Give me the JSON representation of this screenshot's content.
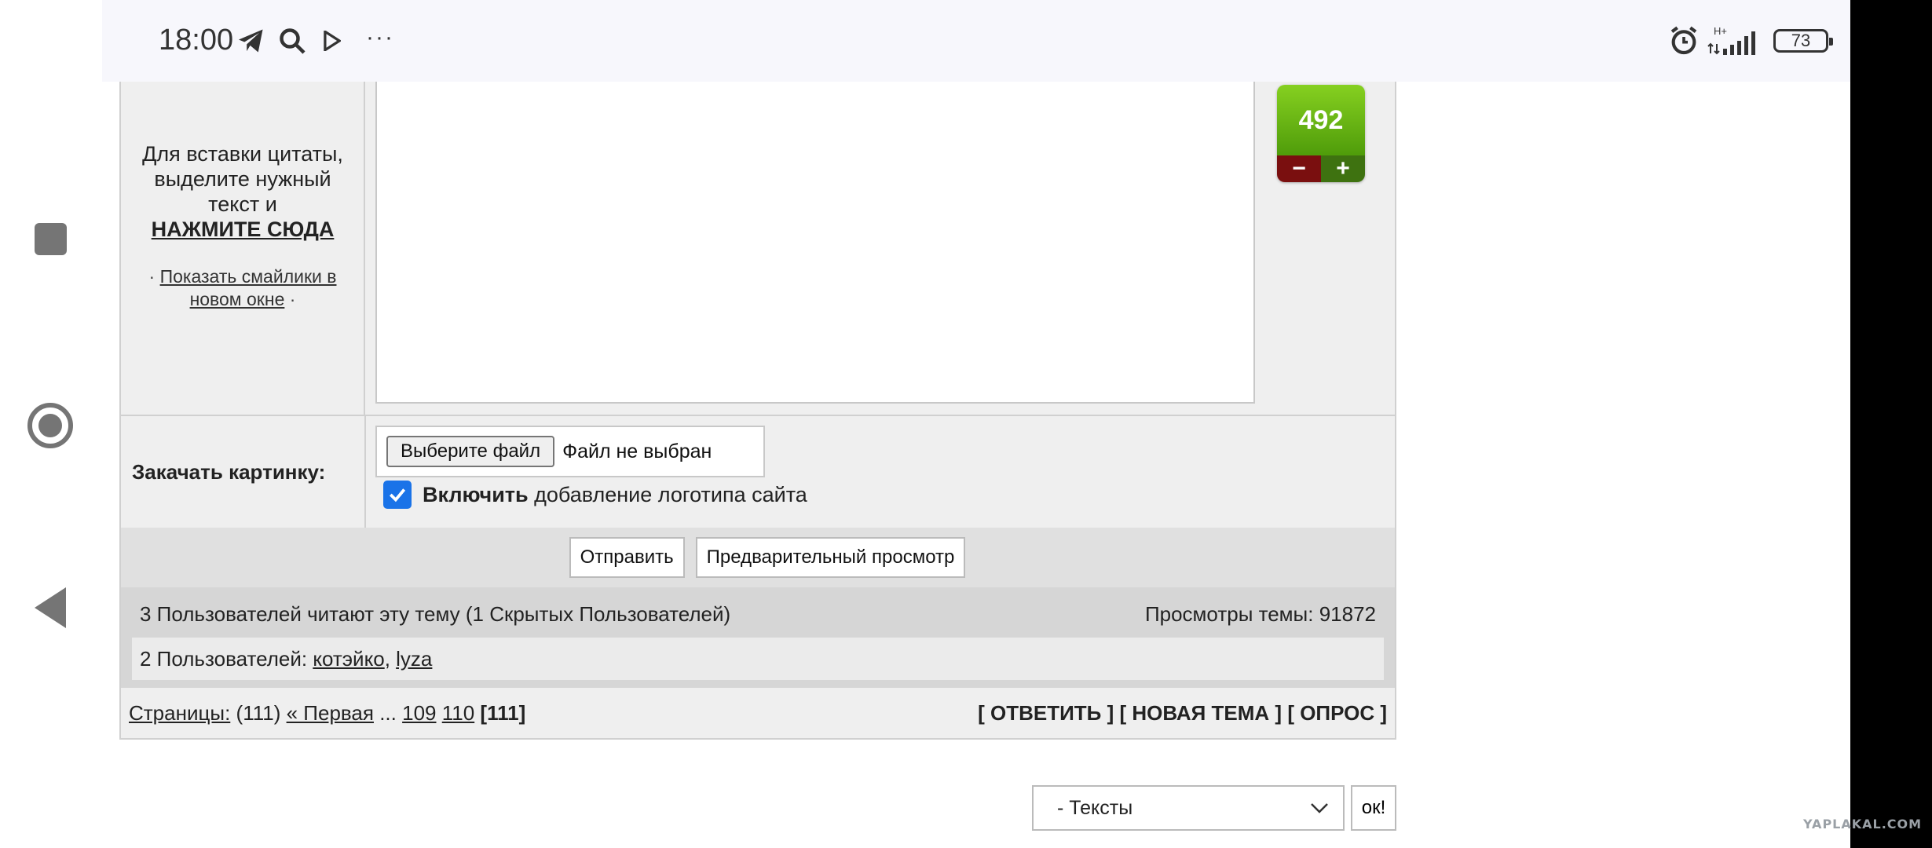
{
  "status_bar": {
    "time": "18:00",
    "network": "H+",
    "battery": "73",
    "more_icon": "···"
  },
  "editor": {
    "hint_line1": "Для вставки цитаты, выделите нужный текст и",
    "hint_link": "НАЖМИТЕ СЮДА",
    "smiles_prefix": "·",
    "smiles_link": "Показать смайлики в новом окне",
    "smiles_suffix": "·",
    "textarea_value": ""
  },
  "rating": {
    "value": "492",
    "minus": "−",
    "plus": "+"
  },
  "upload": {
    "label": "Закачать картинку:",
    "file_button": "Выберите файл",
    "file_status": "Файл не выбран",
    "logo_bold": "Включить",
    "logo_text": "добавление логотипа сайта",
    "logo_checked": true
  },
  "submit": {
    "send": "Отправить",
    "preview": "Предварительный просмотр"
  },
  "readers": {
    "summary": "3 Пользователей читают эту тему (1 Скрытых Пользователей)",
    "views": "Просмотры темы: 91872",
    "users_prefix": "2 Пользователей:",
    "users": [
      "котэйко",
      "lyza"
    ]
  },
  "pagination": {
    "label": "Страницы:",
    "total": "(111)",
    "first": "« Первая",
    "ellipsis": "...",
    "pages": [
      "109",
      "110"
    ],
    "current": "[111]"
  },
  "actions": {
    "reply": "[ ОТВЕТИТЬ ]",
    "new_topic": "[ НОВАЯ ТЕМА ]",
    "poll": "[ ОПРОС ]"
  },
  "jump": {
    "selected": "- Тексты",
    "ok": "ок!"
  },
  "watermark": "YAPLAKAL.COM"
}
